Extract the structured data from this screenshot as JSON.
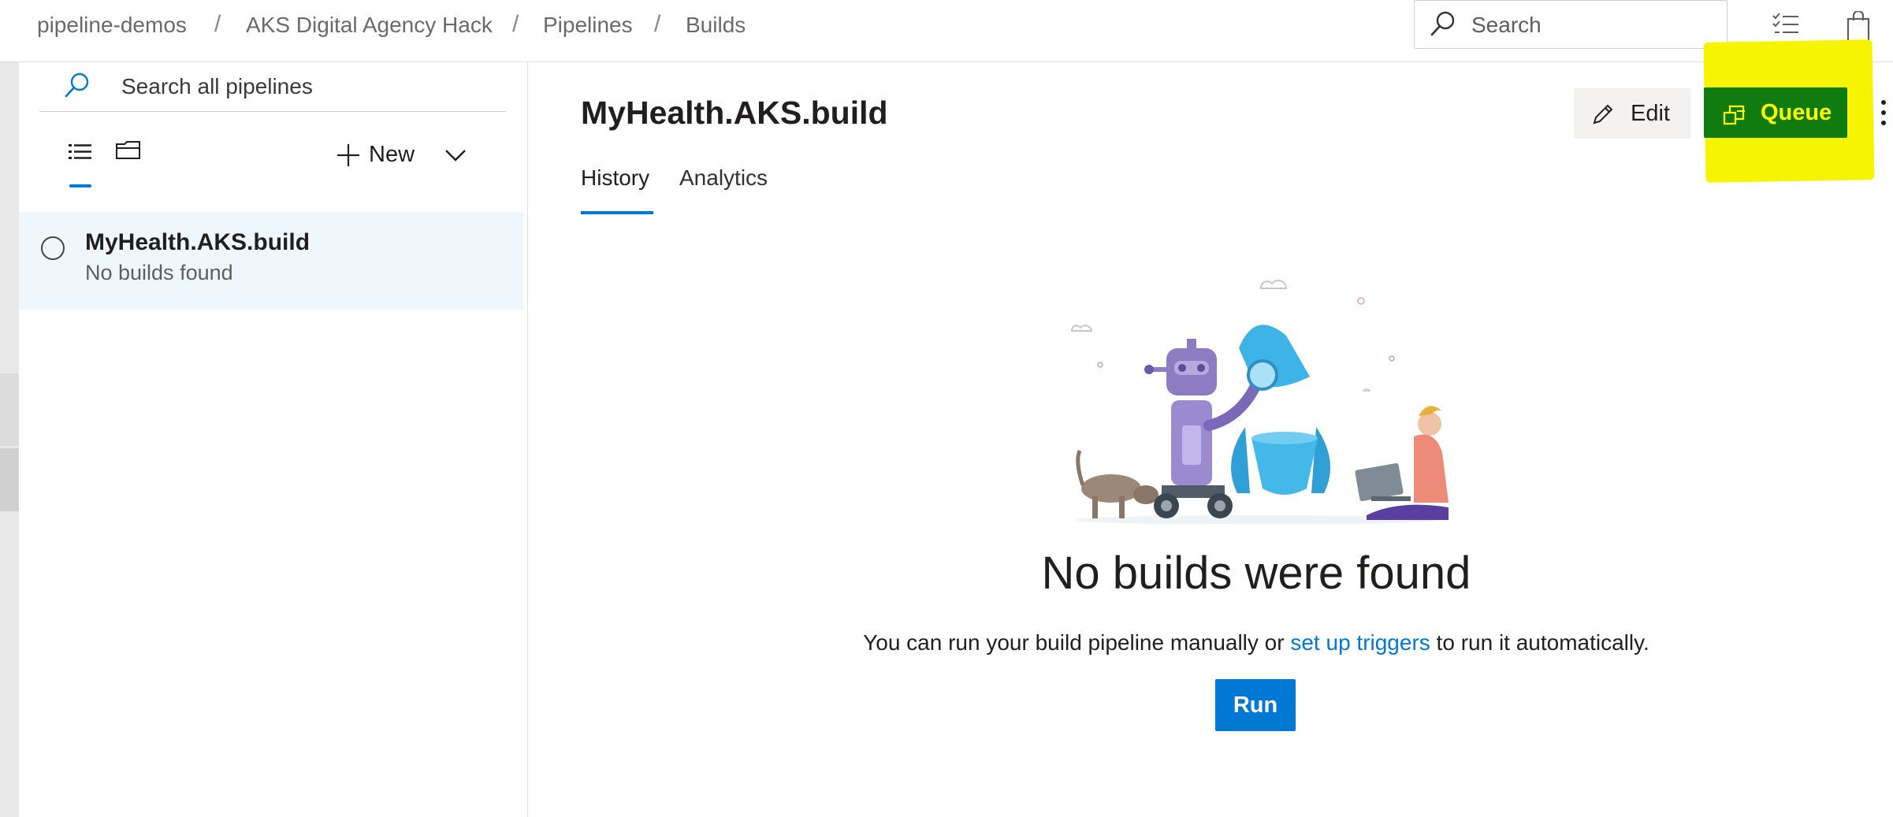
{
  "breadcrumb": {
    "items": [
      "pipeline-demos",
      "AKS Digital Agency Hack",
      "Pipelines",
      "Builds"
    ],
    "separator": "/"
  },
  "header": {
    "search_placeholder": "Search"
  },
  "sidebar": {
    "search_placeholder": "Search all pipelines",
    "new_label": "New",
    "pipelines": [
      {
        "name": "MyHealth.AKS.build",
        "status": "No builds found"
      }
    ]
  },
  "main": {
    "title": "MyHealth.AKS.build",
    "tabs": [
      {
        "label": "History",
        "active": true
      },
      {
        "label": "Analytics",
        "active": false
      }
    ],
    "edit_label": "Edit",
    "queue_label": "Queue",
    "empty_state": {
      "title": "No builds were found",
      "desc_before": "You can run your build pipeline manually or ",
      "desc_link": "set up triggers",
      "desc_after": " to run it automatically.",
      "run_label": "Run"
    }
  },
  "colors": {
    "accent": "#0078d4",
    "queue_button": "#107c10",
    "highlight": "#f7f400"
  }
}
